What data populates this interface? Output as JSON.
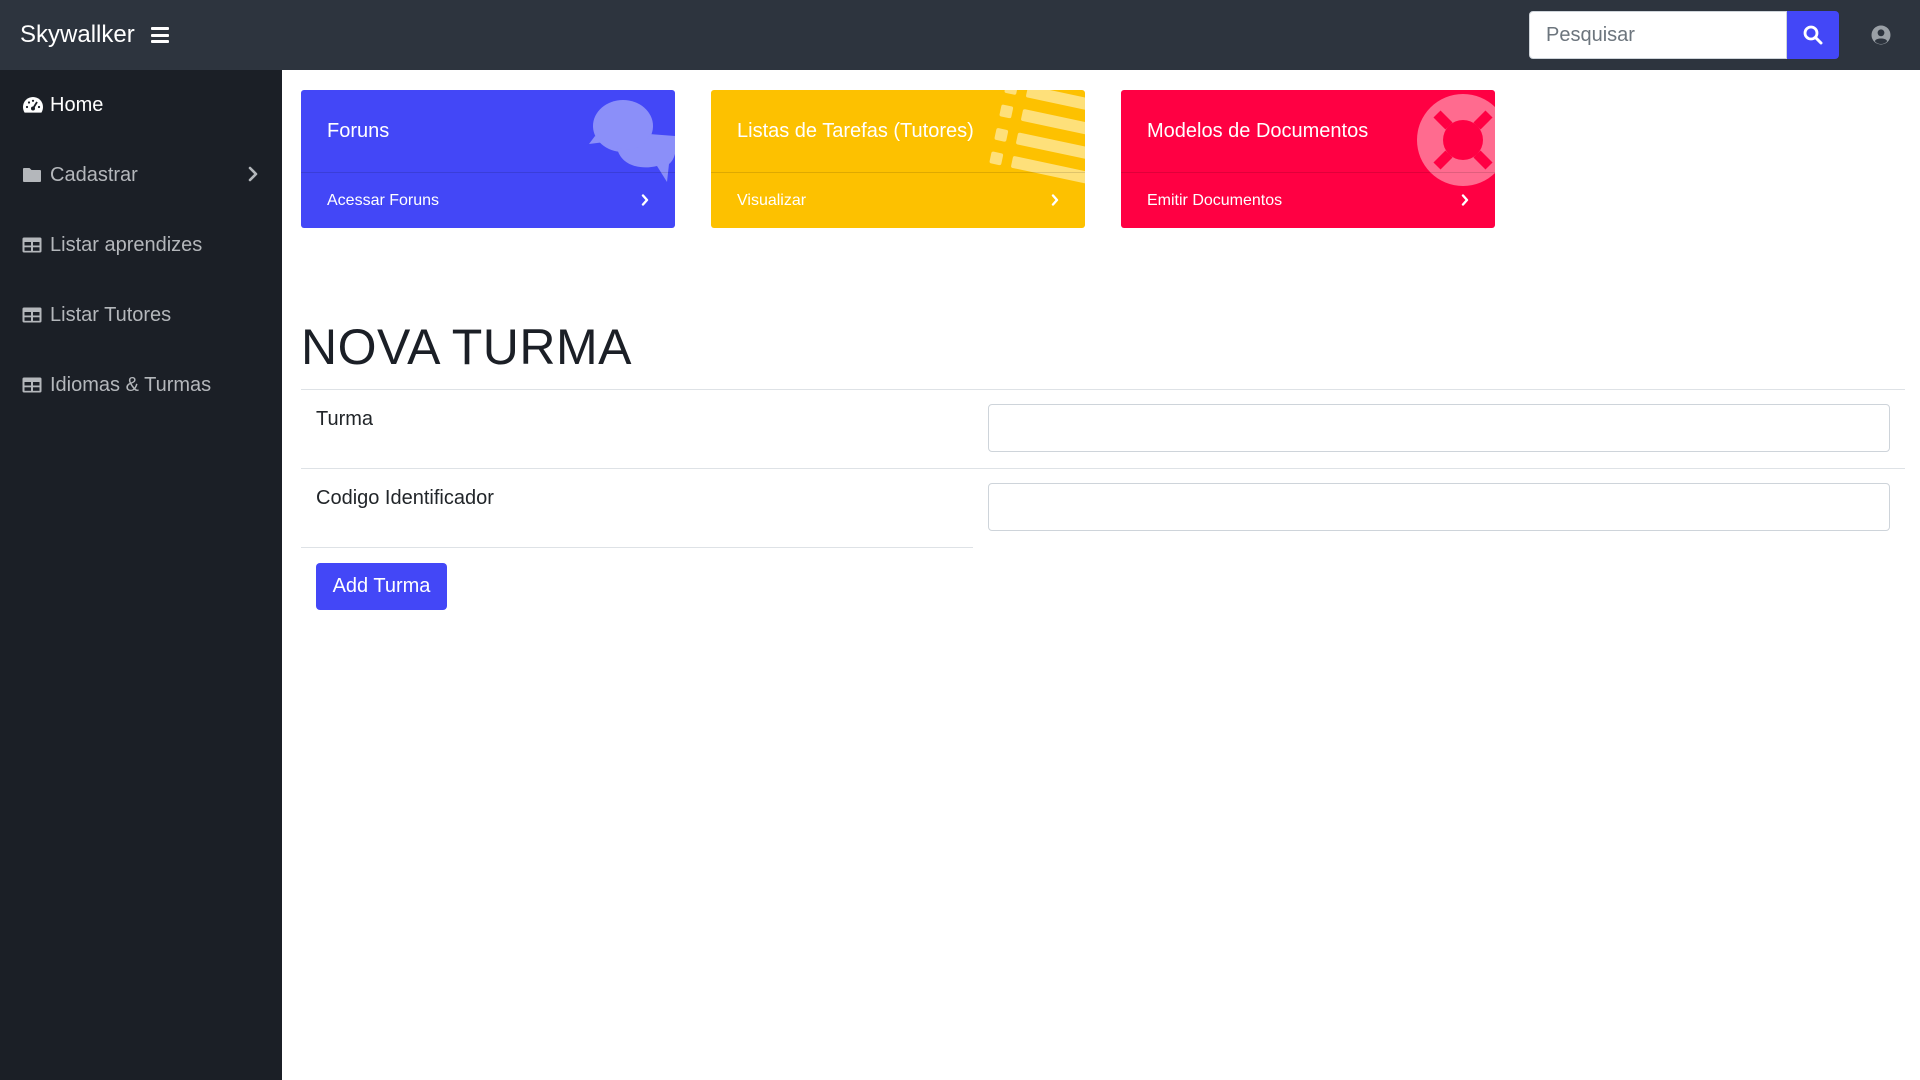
{
  "navbar": {
    "brand": "Skywallker",
    "menu_icon": "hamburger-icon",
    "search_placeholder": "Pesquisar",
    "search_icon": "search-icon",
    "user_icon": "user-circle-icon"
  },
  "sidebar": {
    "items": [
      {
        "label": "Home",
        "icon": "dashboard-icon",
        "active": true
      },
      {
        "label": "Cadastrar",
        "icon": "folder-icon",
        "has_submenu": true
      },
      {
        "label": "Listar aprendizes",
        "icon": "table-icon"
      },
      {
        "label": "Listar Tutores",
        "icon": "table-icon"
      },
      {
        "label": "Idiomas & Turmas",
        "icon": "table-icon"
      }
    ]
  },
  "cards": [
    {
      "title": "Foruns",
      "link": "Acessar Foruns",
      "color": "#4347f7",
      "icon": "comments-icon"
    },
    {
      "title": "Listas de Tarefas (Tutores)",
      "link": "Visualizar",
      "color": "#fdc100",
      "icon": "list-icon"
    },
    {
      "title": "Modelos de Documentos",
      "link": "Emitir Documentos",
      "color": "#ff0043",
      "icon": "life-ring-icon"
    }
  ],
  "form": {
    "title": "NOVA TURMA",
    "fields": [
      {
        "label": "Turma",
        "value": ""
      },
      {
        "label": "Codigo Identificador",
        "value": ""
      }
    ],
    "submit_label": "Add Turma"
  },
  "colors": {
    "navbar": "#2d343e",
    "sidebar": "#1b1f26",
    "primary": "#4347f7",
    "warning": "#fdc100",
    "danger": "#ff0043"
  }
}
